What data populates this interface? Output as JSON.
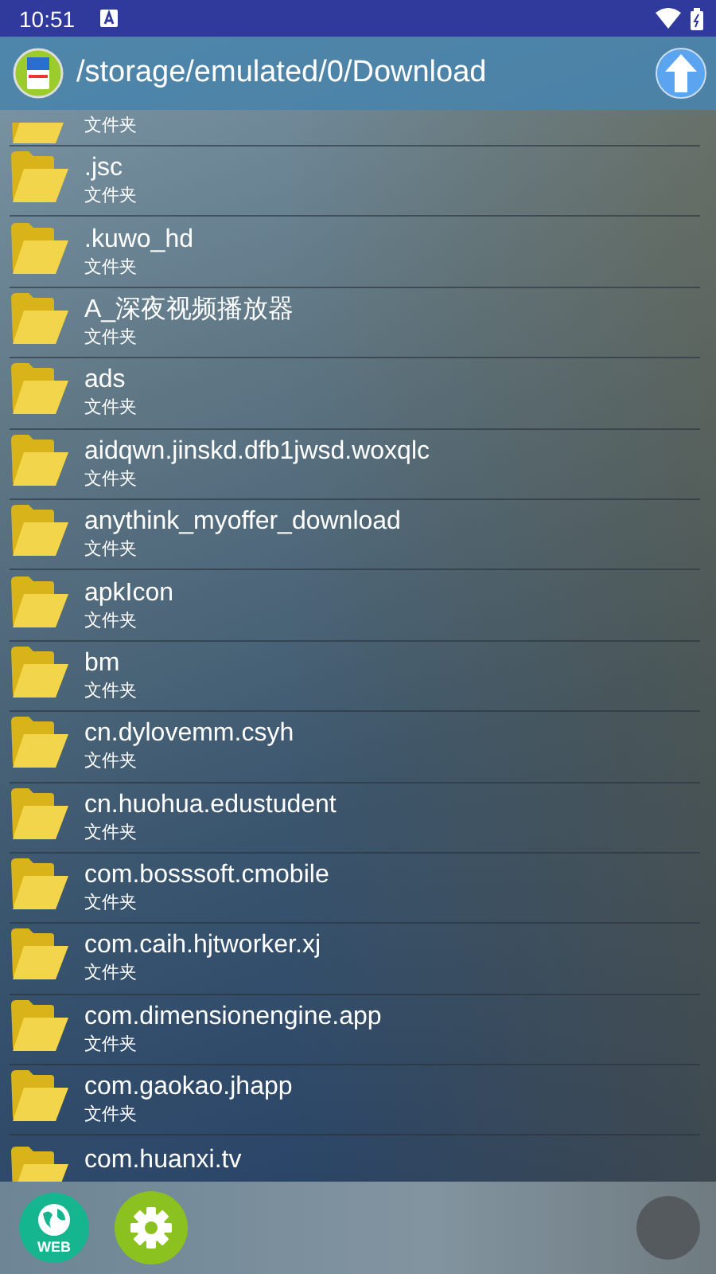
{
  "status_bar": {
    "time": "10:51"
  },
  "header": {
    "path": "/storage/emulated/0/Download"
  },
  "files": [
    {
      "subtitle": "文件夹"
    },
    {
      "name": ".jsc",
      "subtitle": "文件夹"
    },
    {
      "name": ".kuwo_hd",
      "subtitle": "文件夹"
    },
    {
      "name": "A_深夜视频播放器",
      "subtitle": "文件夹"
    },
    {
      "name": "ads",
      "subtitle": "文件夹"
    },
    {
      "name": "aidqwn.jinskd.dfb1jwsd.woxqlc",
      "subtitle": "文件夹"
    },
    {
      "name": "anythink_myoffer_download",
      "subtitle": "文件夹"
    },
    {
      "name": "apkIcon",
      "subtitle": "文件夹"
    },
    {
      "name": "bm",
      "subtitle": "文件夹"
    },
    {
      "name": "cn.dylovemm.csyh",
      "subtitle": "文件夹"
    },
    {
      "name": "cn.huohua.edustudent",
      "subtitle": "文件夹"
    },
    {
      "name": "com.bosssoft.cmobile",
      "subtitle": "文件夹"
    },
    {
      "name": "com.caih.hjtworker.xj",
      "subtitle": "文件夹"
    },
    {
      "name": "com.dimensionengine.app",
      "subtitle": "文件夹"
    },
    {
      "name": "com.gaokao.jhapp",
      "subtitle": "文件夹"
    },
    {
      "name": "com.huanxi.tv"
    }
  ],
  "bottom_bar": {
    "web_label": "WEB"
  }
}
